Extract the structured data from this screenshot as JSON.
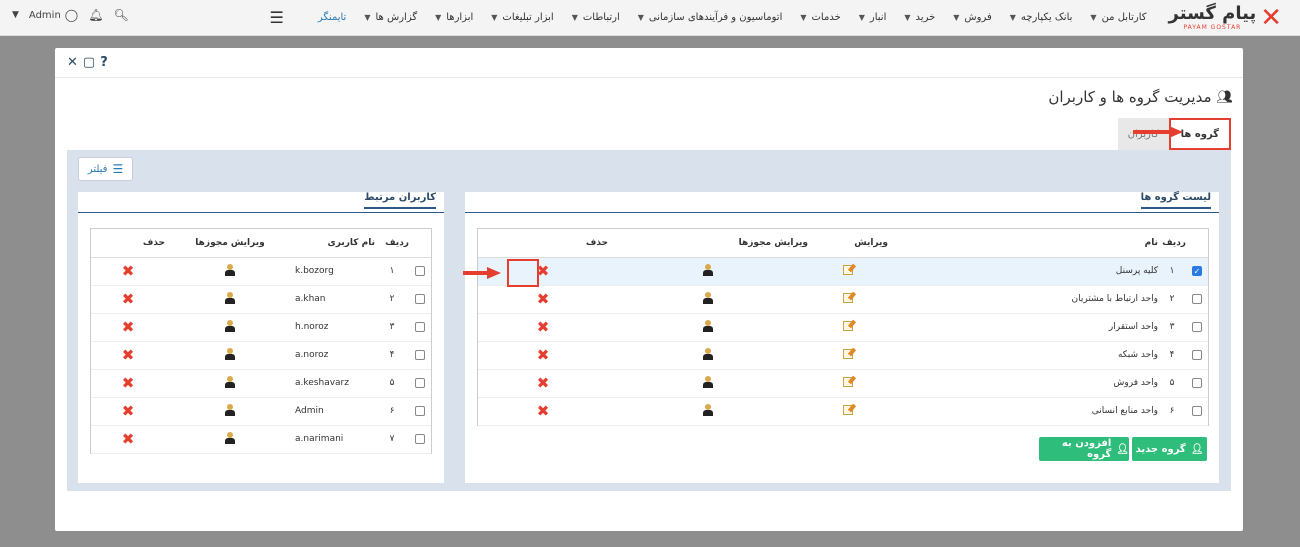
{
  "app": {
    "logo_name": "پیام گستر",
    "logo_sub": "PAYAM GOSTAR"
  },
  "topmenu": [
    {
      "label": "کارتابل من"
    },
    {
      "label": "بانک یکپارچه"
    },
    {
      "label": "فروش"
    },
    {
      "label": "خرید"
    },
    {
      "label": "انبار"
    },
    {
      "label": "خدمات"
    },
    {
      "label": "اتوماسیون و فرآیندهای سازمانی"
    },
    {
      "label": "ارتباطات"
    },
    {
      "label": "ابزار تبلیغات"
    },
    {
      "label": "ابزارها"
    },
    {
      "label": "گزارش ها"
    }
  ],
  "timer_label": "تایمنگر",
  "user": {
    "name": "Admin"
  },
  "modal": {
    "title": "مدیریت گروه ها و کاربران",
    "tabs": {
      "groups": "گروه ها",
      "users": "کاربران"
    },
    "filter_label": "فیلتر"
  },
  "groups": {
    "title": "لیست گروه ها",
    "headers": {
      "row": "ردیف",
      "name": "نام",
      "edit": "ویرایش",
      "perm": "ویرایش مجوزها",
      "delete": "حذف"
    },
    "rows": [
      {
        "num": "۱",
        "name": "کلیه پرسنل",
        "checked": true
      },
      {
        "num": "۲",
        "name": "واحد ارتباط با مشتریان",
        "checked": false
      },
      {
        "num": "۳",
        "name": "واحد استقرار",
        "checked": false
      },
      {
        "num": "۴",
        "name": "واحد شبکه",
        "checked": false
      },
      {
        "num": "۵",
        "name": "واحد فروش",
        "checked": false
      },
      {
        "num": "۶",
        "name": "واحد منابع انسانی",
        "checked": false
      }
    ],
    "btn_new": "گروه جدید",
    "btn_add": "افزودن به گروه"
  },
  "users": {
    "title": "کاربران مرتبط",
    "headers": {
      "row": "ردیف",
      "username": "نام کاربری",
      "perm": "ویرایش مجوزها",
      "delete": "حذف"
    },
    "rows": [
      {
        "num": "۱",
        "username": "k.bozorg"
      },
      {
        "num": "۲",
        "username": "a.khan"
      },
      {
        "num": "۳",
        "username": "h.noroz"
      },
      {
        "num": "۴",
        "username": "a.noroz"
      },
      {
        "num": "۵",
        "username": "a.keshavarz"
      },
      {
        "num": "۶",
        "username": "Admin"
      },
      {
        "num": "۷",
        "username": "a.narimani"
      }
    ]
  }
}
